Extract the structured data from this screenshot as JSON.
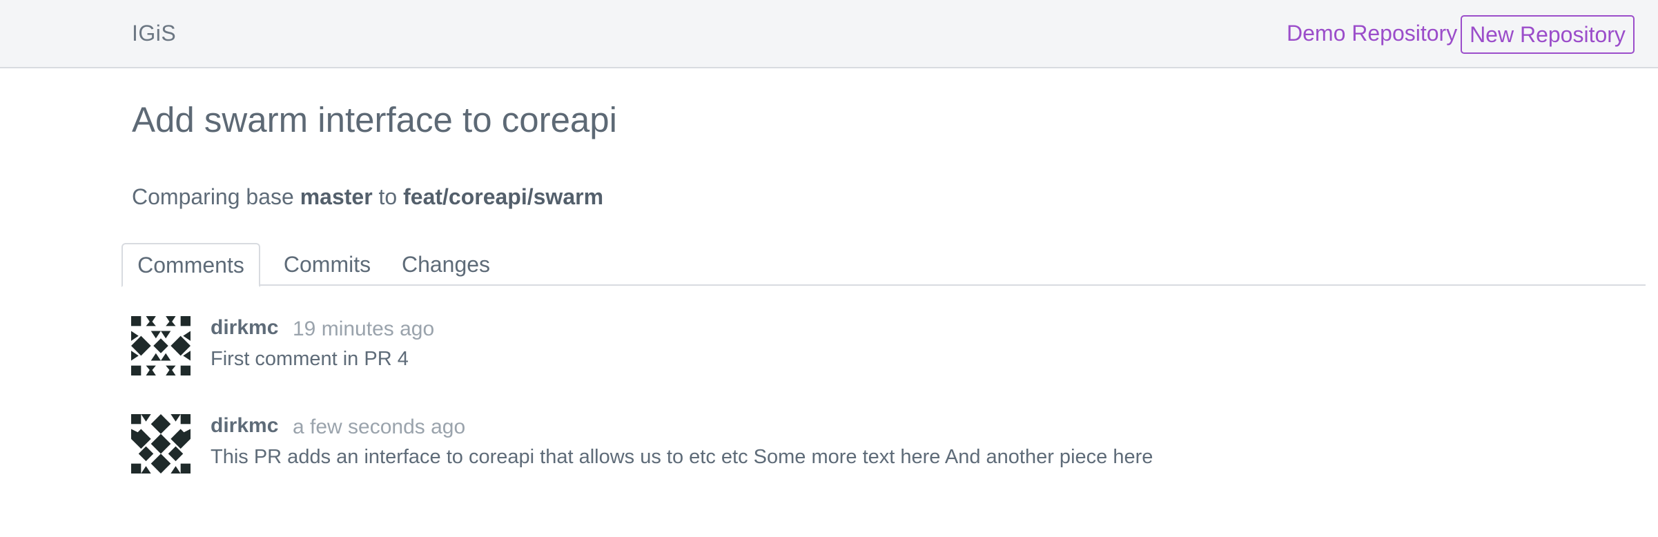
{
  "navbar": {
    "brand": "IGiS",
    "demo_link": "Demo Repository",
    "new_button": "New Repository"
  },
  "page": {
    "title": "Add swarm interface to coreapi",
    "comparing_prefix": "Comparing base",
    "base_branch": "master",
    "comparing_to": "to",
    "head_branch": "feat/coreapi/swarm"
  },
  "tabs": [
    {
      "label": "Comments",
      "active": true
    },
    {
      "label": "Commits",
      "active": false
    },
    {
      "label": "Changes",
      "active": false
    }
  ],
  "comments": [
    {
      "author": "dirkmc",
      "time": "19 minutes ago",
      "body": "First comment in PR 4",
      "avatar_icon": "identicon-avatar"
    },
    {
      "author": "dirkmc",
      "time": "a few seconds ago",
      "body": "This PR adds an interface to coreapi that allows us to etc etc Some more text here And another piece here",
      "avatar_icon": "identicon-avatar"
    }
  ],
  "colors": {
    "accent": "#9b4dca",
    "navbar_bg": "#f4f5f7",
    "text": "#5e6b78",
    "muted": "#9aa3ac"
  }
}
